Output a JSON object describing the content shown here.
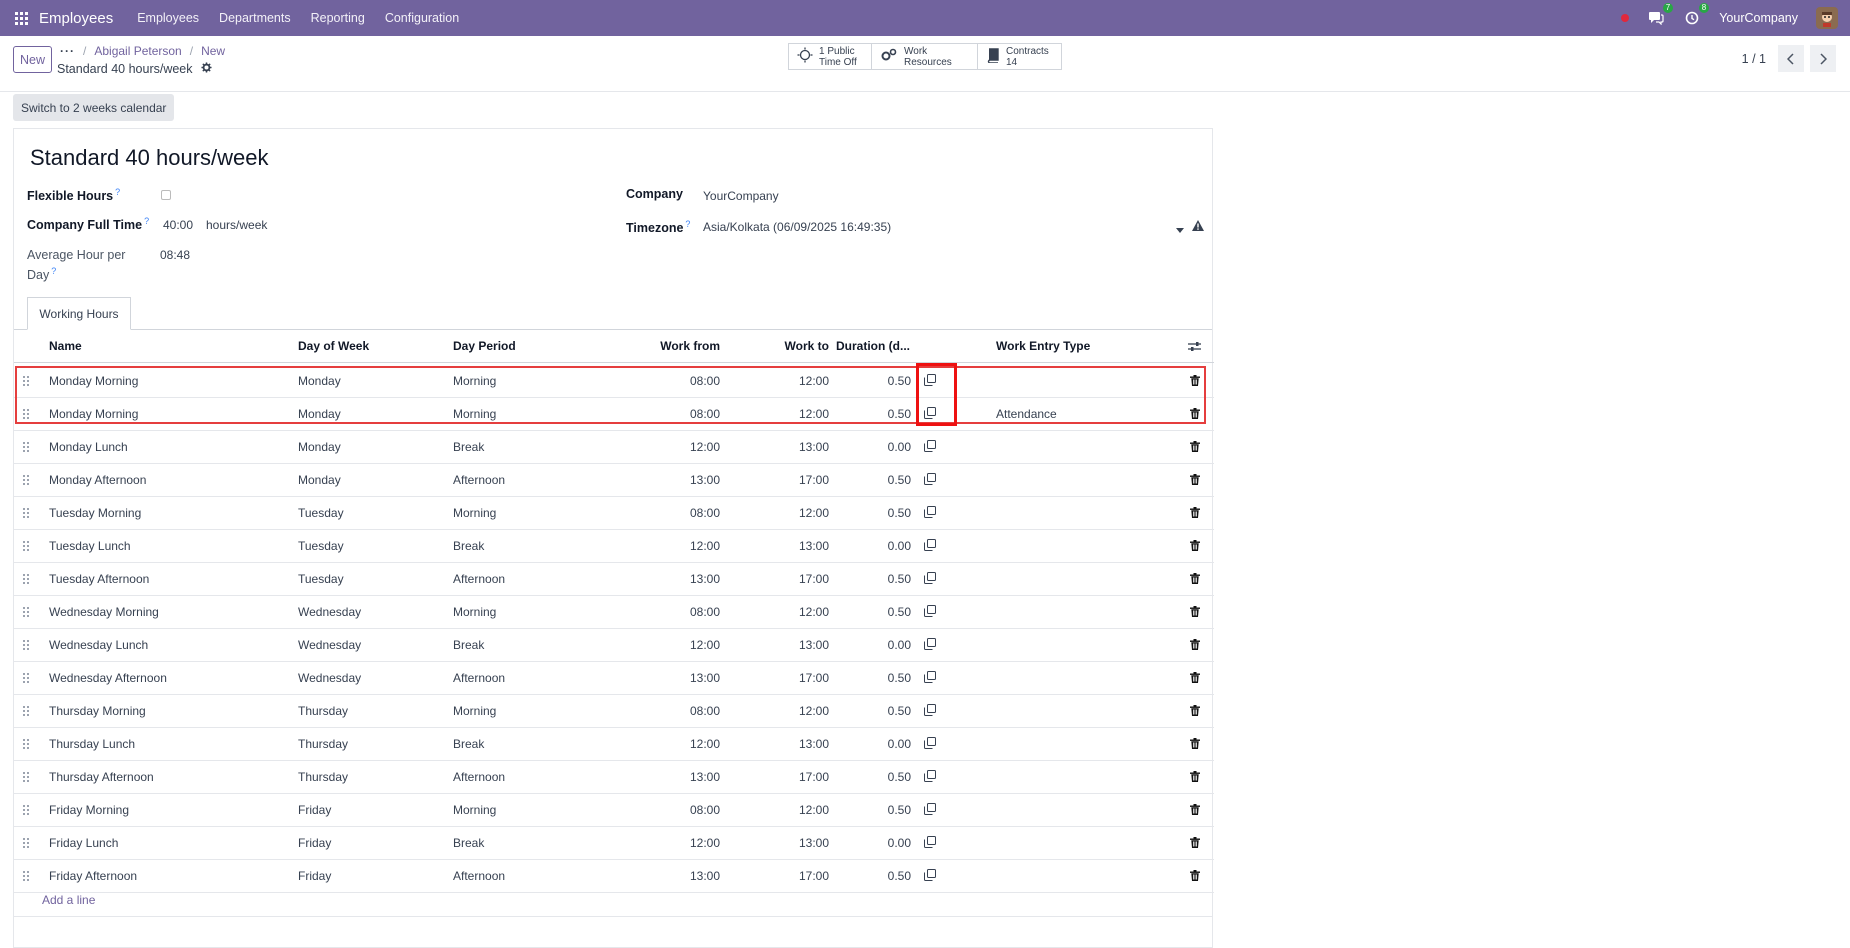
{
  "topnav": {
    "brand": "Employees",
    "menu": [
      "Employees",
      "Departments",
      "Reporting",
      "Configuration"
    ],
    "chat_count": "7",
    "activity_count": "8",
    "company": "YourCompany"
  },
  "control": {
    "new_label": "New",
    "breadcrumb": [
      "Abigail Peterson",
      "New"
    ],
    "record_title": "Standard 40 hours/week",
    "smart_buttons": [
      {
        "line1": "1 Public",
        "line2": "Time Off",
        "icon": "sun-icon"
      },
      {
        "line1": "Work Resources",
        "line2": "",
        "icon": "gears-icon"
      },
      {
        "line1": "Contracts",
        "line2": "14",
        "icon": "book-icon"
      }
    ],
    "pager": "1 / 1"
  },
  "switch_label": "Switch to 2 weeks calendar",
  "form": {
    "title": "Standard 40 hours/week",
    "flexible_hours_label": "Flexible Hours",
    "full_time_label": "Company Full Time",
    "full_time_value": "40:00",
    "full_time_unit": "hours/week",
    "avg_hour_label_1": "Average Hour per",
    "avg_hour_label_2": "Day",
    "avg_hour_value": "08:48",
    "company_label": "Company",
    "company_value": "YourCompany",
    "timezone_label": "Timezone",
    "timezone_value": "Asia/Kolkata (06/09/2025 16:49:35)",
    "help_mark": "?"
  },
  "tab_label": "Working Hours",
  "table": {
    "headers": {
      "name": "Name",
      "day": "Day of Week",
      "period": "Day Period",
      "from": "Work from",
      "to": "Work to",
      "duration": "Duration (d...",
      "entry_type": "Work Entry Type"
    },
    "rows": [
      {
        "name": "Monday Morning",
        "day": "Monday",
        "period": "Morning",
        "from": "08:00",
        "to": "12:00",
        "duration": "0.50",
        "entry_type": ""
      },
      {
        "name": "Monday Morning",
        "day": "Monday",
        "period": "Morning",
        "from": "08:00",
        "to": "12:00",
        "duration": "0.50",
        "entry_type": "Attendance"
      },
      {
        "name": "Monday Lunch",
        "day": "Monday",
        "period": "Break",
        "from": "12:00",
        "to": "13:00",
        "duration": "0.00",
        "entry_type": ""
      },
      {
        "name": "Monday Afternoon",
        "day": "Monday",
        "period": "Afternoon",
        "from": "13:00",
        "to": "17:00",
        "duration": "0.50",
        "entry_type": ""
      },
      {
        "name": "Tuesday Morning",
        "day": "Tuesday",
        "period": "Morning",
        "from": "08:00",
        "to": "12:00",
        "duration": "0.50",
        "entry_type": ""
      },
      {
        "name": "Tuesday Lunch",
        "day": "Tuesday",
        "period": "Break",
        "from": "12:00",
        "to": "13:00",
        "duration": "0.00",
        "entry_type": ""
      },
      {
        "name": "Tuesday Afternoon",
        "day": "Tuesday",
        "period": "Afternoon",
        "from": "13:00",
        "to": "17:00",
        "duration": "0.50",
        "entry_type": ""
      },
      {
        "name": "Wednesday Morning",
        "day": "Wednesday",
        "period": "Morning",
        "from": "08:00",
        "to": "12:00",
        "duration": "0.50",
        "entry_type": ""
      },
      {
        "name": "Wednesday Lunch",
        "day": "Wednesday",
        "period": "Break",
        "from": "12:00",
        "to": "13:00",
        "duration": "0.00",
        "entry_type": ""
      },
      {
        "name": "Wednesday Afternoon",
        "day": "Wednesday",
        "period": "Afternoon",
        "from": "13:00",
        "to": "17:00",
        "duration": "0.50",
        "entry_type": ""
      },
      {
        "name": "Thursday Morning",
        "day": "Thursday",
        "period": "Morning",
        "from": "08:00",
        "to": "12:00",
        "duration": "0.50",
        "entry_type": ""
      },
      {
        "name": "Thursday Lunch",
        "day": "Thursday",
        "period": "Break",
        "from": "12:00",
        "to": "13:00",
        "duration": "0.00",
        "entry_type": ""
      },
      {
        "name": "Thursday Afternoon",
        "day": "Thursday",
        "period": "Afternoon",
        "from": "13:00",
        "to": "17:00",
        "duration": "0.50",
        "entry_type": ""
      },
      {
        "name": "Friday Morning",
        "day": "Friday",
        "period": "Morning",
        "from": "08:00",
        "to": "12:00",
        "duration": "0.50",
        "entry_type": ""
      },
      {
        "name": "Friday Lunch",
        "day": "Friday",
        "period": "Break",
        "from": "12:00",
        "to": "13:00",
        "duration": "0.00",
        "entry_type": ""
      },
      {
        "name": "Friday Afternoon",
        "day": "Friday",
        "period": "Afternoon",
        "from": "13:00",
        "to": "17:00",
        "duration": "0.50",
        "entry_type": ""
      }
    ],
    "add_line": "Add a line"
  },
  "colors": {
    "brand": "#71639e",
    "highlight": "#e53e3e"
  }
}
